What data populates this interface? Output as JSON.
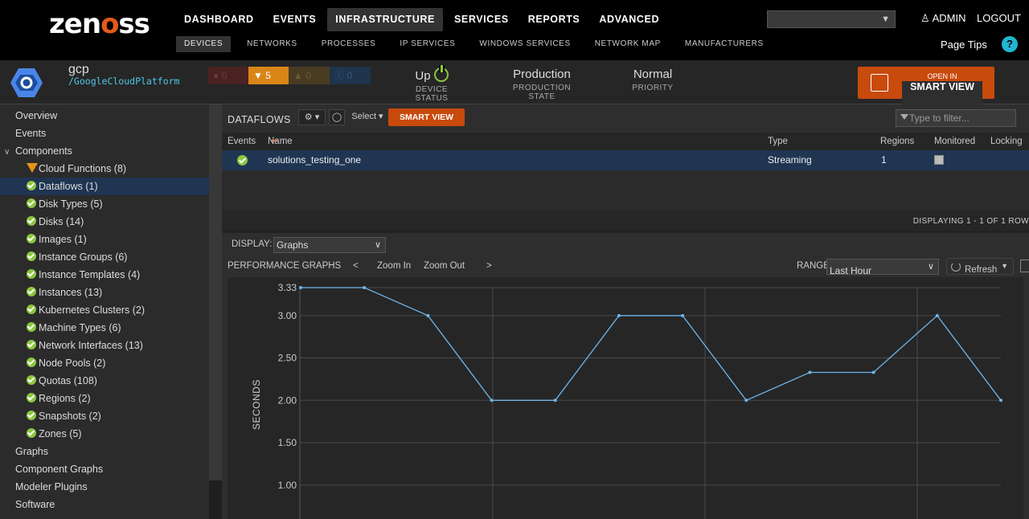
{
  "nav": {
    "logo": "zenoss",
    "main": [
      "DASHBOARD",
      "EVENTS",
      "INFRASTRUCTURE",
      "SERVICES",
      "REPORTS",
      "ADVANCED"
    ],
    "sub": [
      "DEVICES",
      "NETWORKS",
      "PROCESSES",
      "IP SERVICES",
      "WINDOWS SERVICES",
      "NETWORK MAP",
      "MANUFACTURERS"
    ],
    "user": "ADMIN",
    "logout": "LOGOUT",
    "page_tips": "Page Tips",
    "help": "?"
  },
  "device": {
    "name": "gcp",
    "path": "/GoogleCloudPlatform",
    "events": {
      "critical": "0",
      "error": "5",
      "warning": "0",
      "info": "0"
    },
    "status": {
      "value": "Up",
      "label": "DEVICE STATUS"
    },
    "production": {
      "value": "Production",
      "label": "PRODUCTION STATE"
    },
    "priority": {
      "value": "Normal",
      "label": "PRIORITY"
    },
    "smart_view": {
      "top": "OPEN IN",
      "main": "SMART VIEW"
    }
  },
  "sidebar": {
    "items": [
      {
        "label": "Overview"
      },
      {
        "label": "Events"
      },
      {
        "label": "Components"
      },
      {
        "label": "Cloud Functions (8)"
      },
      {
        "label": "Dataflows (1)"
      },
      {
        "label": "Disk Types (5)"
      },
      {
        "label": "Disks (14)"
      },
      {
        "label": "Images (1)"
      },
      {
        "label": "Instance Groups (6)"
      },
      {
        "label": "Instance Templates (4)"
      },
      {
        "label": "Instances (13)"
      },
      {
        "label": "Kubernetes Clusters (2)"
      },
      {
        "label": "Machine Types (6)"
      },
      {
        "label": "Network Interfaces (13)"
      },
      {
        "label": "Node Pools (2)"
      },
      {
        "label": "Quotas (108)"
      },
      {
        "label": "Regions (2)"
      },
      {
        "label": "Snapshots (2)"
      },
      {
        "label": "Zones (5)"
      },
      {
        "label": "Graphs"
      },
      {
        "label": "Component Graphs"
      },
      {
        "label": "Modeler Plugins"
      },
      {
        "label": "Software"
      }
    ]
  },
  "grid": {
    "title": "DATAFLOWS",
    "select_label": "Select",
    "smart_view": "SMART VIEW",
    "filter_placeholder": "Type to filter...",
    "columns": [
      "Events",
      "Name",
      "Type",
      "Regions",
      "Monitored",
      "Locking"
    ],
    "rows": [
      {
        "name": "solutions_testing_one",
        "type": "Streaming",
        "regions": "1",
        "monitored": true
      }
    ],
    "footer": "DISPLAYING 1 - 1 OF 1 ROW"
  },
  "display": {
    "label": "DISPLAY:",
    "value": "Graphs"
  },
  "perf": {
    "title": "PERFORMANCE GRAPHS",
    "prev": "<",
    "zoom_in": "Zoom In",
    "zoom_out": "Zoom Out",
    "next": ">",
    "range_label": "RANGE:",
    "range_value": "Last Hour",
    "refresh": "Refresh"
  },
  "chart_data": {
    "type": "line",
    "ylabel": "SECONDS",
    "y_ticks": [
      "3.33",
      "3.00",
      "2.50",
      "2.00",
      "1.50",
      "1.00"
    ],
    "ylim": [
      0.6,
      3.33
    ],
    "grid": true,
    "series": [
      {
        "values": [
          3.33,
          3.33,
          3.0,
          2.0,
          2.0,
          3.0,
          3.0,
          2.0,
          2.33,
          2.33,
          3.0,
          2.0
        ]
      }
    ],
    "line_color": "#6fb4e8"
  }
}
